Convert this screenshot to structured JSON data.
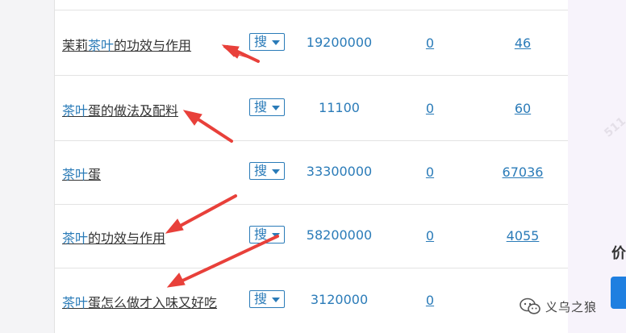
{
  "search_button_label": "搜",
  "rows": [
    {
      "keyword_parts": [
        "茉莉",
        "茶叶",
        "的功效与作用"
      ],
      "volume": "19200000",
      "col_a": "0",
      "col_b": "46"
    },
    {
      "keyword_parts": [
        "",
        "茶叶",
        "蛋的做法及配料"
      ],
      "volume": "11100",
      "col_a": "0",
      "col_b": "60"
    },
    {
      "keyword_parts": [
        "",
        "茶叶",
        "蛋"
      ],
      "volume": "33300000",
      "col_a": "0",
      "col_b": "67036"
    },
    {
      "keyword_parts": [
        "",
        "茶叶",
        "的功效与作用"
      ],
      "volume": "58200000",
      "col_a": "0",
      "col_b": "4055"
    },
    {
      "keyword_parts": [
        "",
        "茶叶",
        "蛋怎么做才入味又好吃"
      ],
      "volume": "3120000",
      "col_a": "0",
      "col_b": ""
    }
  ],
  "side_panel": {
    "partial_char": "价",
    "watermark_text": "511"
  },
  "brand": {
    "name": "义乌之狼",
    "icon": "wechat-icon"
  },
  "colors": {
    "link": "#2a7bb8",
    "arrow": "#e8403a",
    "side_button": "#1f7fe0"
  }
}
